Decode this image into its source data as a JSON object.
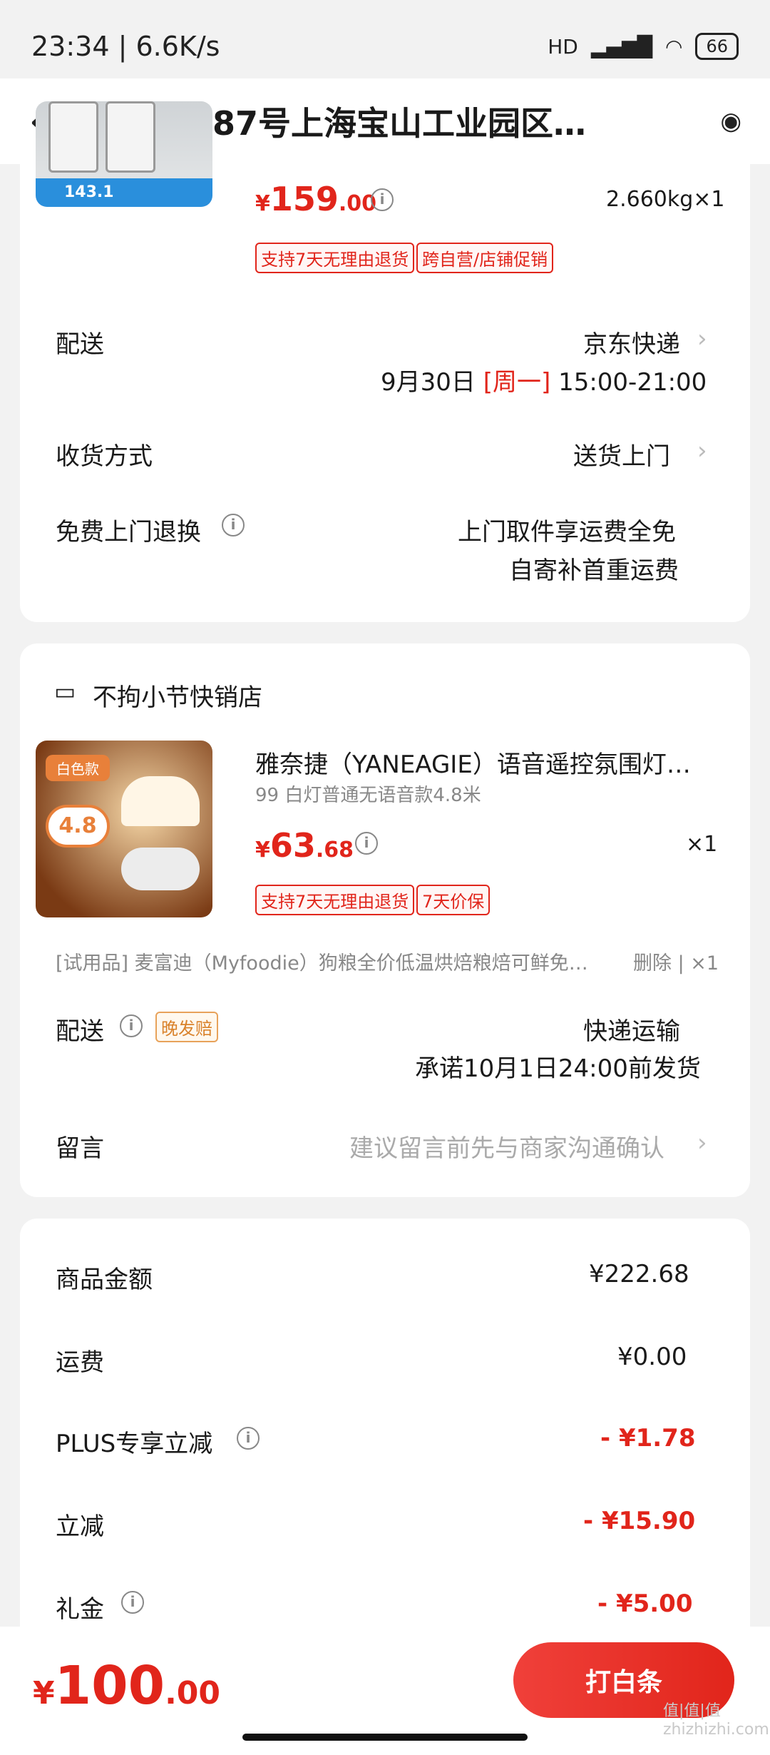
{
  "status_bar": {
    "time_speed": "23:34 | 6.6K/s",
    "battery": "66",
    "network": "HD"
  },
  "header": {
    "title": "淞宝路87号上海宝山工业园区…"
  },
  "item1": {
    "thumb_price": "143.1",
    "price_yen": "¥",
    "price_int": "159",
    "price_dec": ".00",
    "weight_qty": "2.660kg×1",
    "tags": [
      "支持7天无理由退货",
      "跨自营/店铺促销"
    ]
  },
  "delivery1": {
    "label": "配送",
    "carrier": "京东快递",
    "date": "9月30日",
    "weekday": "[周一]",
    "time": "15:00-21:00"
  },
  "receive": {
    "label": "收货方式",
    "value": "送货上门"
  },
  "free_return": {
    "label": "免费上门退换",
    "line1": "上门取件享运费全免",
    "line2": "自寄补首重运费"
  },
  "shop": {
    "name": "不拘小节快销店",
    "product_title": "雅奈捷（YANEAGIE）语音遥控氛围灯…",
    "variant": "99 白灯普通无语音款4.8米",
    "price_yen": "¥",
    "price_int": "63",
    "price_dec": ".68",
    "qty": "×1",
    "tags": [
      "支持7天无理由退货",
      "7天价保"
    ],
    "thumb_tag": "白色款",
    "thumb_value": "4.8",
    "trial_text": "[试用品]  麦富迪（Myfoodie）狗粮全价低温烘焙粮焙可鲜免…",
    "trial_actions": "删除 | ×1"
  },
  "delivery2": {
    "label": "配送",
    "badge": "晚发赔",
    "method": "快递运输",
    "promise": "承诺10月1日24:00前发货"
  },
  "message": {
    "label": "留言",
    "placeholder": "建议留言前先与商家沟通确认"
  },
  "summary": [
    {
      "label": "商品金额",
      "value": "¥222.68",
      "info": false,
      "discount": false
    },
    {
      "label": "运费",
      "value": "¥0.00",
      "info": false,
      "discount": false
    },
    {
      "label": "PLUS专享立减",
      "value": "- ¥1.78",
      "info": true,
      "discount": true
    },
    {
      "label": "立减",
      "value": "- ¥15.90",
      "info": false,
      "discount": true
    },
    {
      "label": "礼金",
      "value": "- ¥5.00",
      "info": true,
      "discount": true
    }
  ],
  "bottom": {
    "total_yen": "¥",
    "total_int": "100",
    "total_dec": ".00",
    "pay_label": "打白条"
  },
  "watermark": "值|值|值 zhizhizhi.com",
  "colors": {
    "accent": "#e1251b",
    "background": "#f2f2f2"
  }
}
